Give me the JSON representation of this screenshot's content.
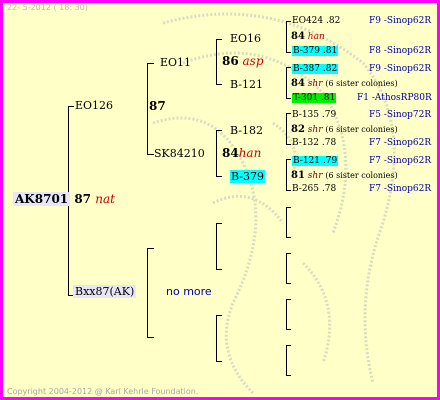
{
  "header": {
    "date": "22-  5-2012 ( 18: 30)"
  },
  "root": {
    "id": "AK8701",
    "num": "87",
    "tag": "nat"
  },
  "gen1": {
    "father": {
      "id": "EO126",
      "num": "87"
    },
    "mother": {
      "id": "Bxx87(AK)",
      "note": "no more"
    }
  },
  "gen2": {
    "ff": {
      "id": "EO11",
      "num": "86",
      "tag": "asp"
    },
    "fm": {
      "id": "SK84210",
      "num": "84",
      "tag": "han"
    }
  },
  "gen3": {
    "fff": {
      "id": "EO16",
      "num": "84",
      "tag": "han"
    },
    "ffm": {
      "id": "B-121",
      "num": "84",
      "tag": "shr",
      "note": "(6 sister colonies)"
    },
    "fmf": {
      "id": "B-182",
      "num": "82",
      "tag": "shr",
      "note": "(6 sister colonies)"
    },
    "fmm": {
      "id": "B-379",
      "num": "81",
      "tag": "shr",
      "note": "(6 sister colonies)"
    }
  },
  "gen4": [
    {
      "id": "EO424",
      "score": ".82",
      "ref": "F9 -Sinop62R"
    },
    {
      "id": "B-379",
      "score": ".81",
      "ref": "F8 -Sinop62R"
    },
    {
      "id": "B-387",
      "score": ".82",
      "ref": "F9 -Sinop62R"
    },
    {
      "id": "T-301",
      "score": ".81",
      "ref": "F1 -AthosRP80R"
    },
    {
      "id": "B-135",
      "score": ".79",
      "ref": "F5 -Sinop72R"
    },
    {
      "id": "B-132",
      "score": ".78",
      "ref": "F7 -Sinop62R"
    },
    {
      "id": "B-121",
      "score": ".79",
      "ref": "F7 -Sinop62R"
    },
    {
      "id": "B-265",
      "score": ".78",
      "ref": "F7 -Sinop62R"
    }
  ],
  "footer": {
    "copyright": "Copyright 2004-2012 @ Karl Kehrle Foundation."
  },
  "colors": {
    "frame": "#ff00ff",
    "background": "#ffffc8",
    "highlight_cyan": "#00ffff",
    "highlight_green": "#00ee00",
    "ref_blue": "#0000aa"
  }
}
